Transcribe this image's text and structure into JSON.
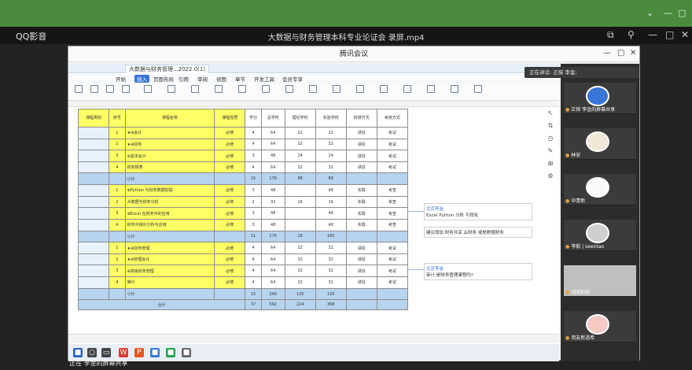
{
  "player": {
    "app_name": "QQ影音",
    "file_title": "大数据与财务管理本科专业论证会 录屏.mp4",
    "share_label": "正在 李金的屏幕共享"
  },
  "meeting": {
    "title": "腾讯会议",
    "speaking": "正在讲话: 正探 李金;"
  },
  "office": {
    "doc_tab": "大数据与财务管理...2022.0(1)",
    "menu": [
      "开始",
      "插入",
      "页面布局",
      "引用",
      "审阅",
      "视图",
      "章节",
      "开发工具",
      "会员专享"
    ],
    "active_menu": "开始"
  },
  "sheet": {
    "header": [
      "课程类别",
      "序号",
      "课程名称",
      "课程性质",
      "学分",
      "总学时",
      "理论学时",
      "实验学时",
      "授课方式",
      "考核方式"
    ],
    "rows": [
      [
        "1",
        "★⊕会计",
        "必修",
        "4",
        "64",
        "32",
        "32",
        "讲授",
        "考试"
      ],
      [
        "2",
        "★⊕财务",
        "必修",
        "4",
        "64",
        "32",
        "32",
        "讲授",
        "考试"
      ],
      [
        "3",
        "⊕成本会计",
        "必修",
        "3",
        "48",
        "24",
        "24",
        "讲授",
        "考试"
      ],
      [
        "4",
        "财务报表",
        "必修",
        "4",
        "64",
        "32",
        "32",
        "讲授",
        "考试"
      ],
      [
        "",
        "小计",
        "",
        "15",
        "176",
        "88",
        "88",
        "",
        ""
      ],
      [
        "1",
        "⊕Python 与财务数据挖掘",
        "必修",
        "3",
        "48",
        "",
        "48",
        "实践",
        "考查"
      ],
      [
        "2",
        "大数据与财务分析",
        "必修",
        "2",
        "32",
        "16",
        "16",
        "实践",
        "考查"
      ],
      [
        "3",
        "⊕Excel 在财务中的应用",
        "必修",
        "3",
        "48",
        "",
        "48",
        "实践",
        "考查"
      ],
      [
        "4",
        "财务可视化分析与应用",
        "必修",
        "3",
        "48",
        "",
        "48",
        "实践",
        "考查"
      ],
      [
        "",
        "小计",
        "",
        "11",
        "176",
        "16",
        "160",
        "",
        ""
      ],
      [
        "1",
        "★⊕财务管理",
        "必修",
        "4",
        "64",
        "32",
        "32",
        "讲授",
        "考试"
      ],
      [
        "2",
        "★⊕管理会计",
        "必修",
        "4",
        "64",
        "32",
        "32",
        "讲授",
        "考试"
      ],
      [
        "3",
        "⊕高级财务管理",
        "必修",
        "4",
        "64",
        "32",
        "32",
        "讲授",
        "考试"
      ],
      [
        "4",
        "审计",
        "必修",
        "4",
        "64",
        "32",
        "32",
        "讲授",
        "考试"
      ],
      [
        "",
        "小计",
        "",
        "15",
        "240",
        "120",
        "120",
        "",
        ""
      ]
    ],
    "total_label": "合计",
    "total_values": [
      "37",
      "592",
      "224",
      "368"
    ]
  },
  "comments": [
    {
      "author": "北京李金",
      "text": "Excel Python 分析 可视化"
    },
    {
      "author": "",
      "text": "建议增加 财务共享 云财务 或是数据财务"
    },
    {
      "author": "北京李金",
      "text": "审计 是财务管理课程吗?"
    }
  ],
  "participants": [
    {
      "name": "正探 李金的屏幕共享"
    },
    {
      "name": "林安"
    },
    {
      "name": "中青新"
    },
    {
      "name": "李毅 | seentao"
    },
    {
      "name": "河北科技"
    },
    {
      "name": "用友新道希"
    }
  ]
}
